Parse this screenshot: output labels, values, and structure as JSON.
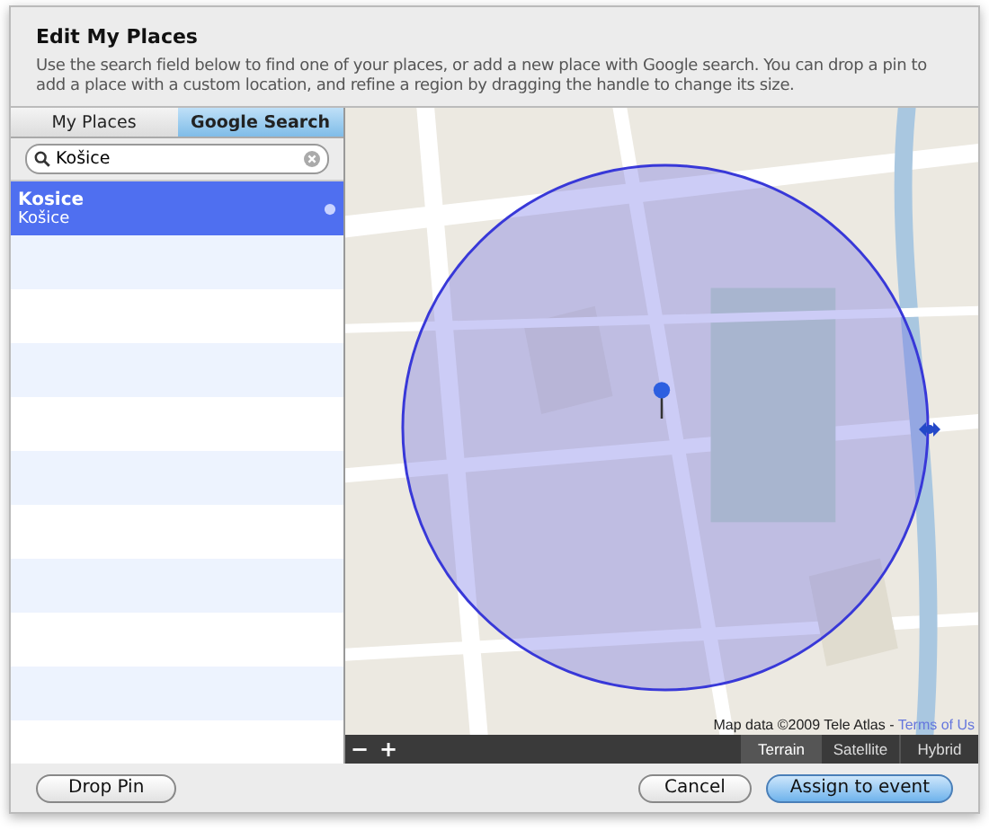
{
  "dialog": {
    "title": "Edit My Places",
    "description": "Use the search field below to find one of your places, or add a new place with Google search. You can drop a pin to add a place with a custom location, and refine a region by dragging the handle to change its size."
  },
  "tabs": [
    {
      "label": "My Places",
      "selected": false
    },
    {
      "label": "Google Search",
      "selected": true
    }
  ],
  "search": {
    "value": "Košice"
  },
  "results": [
    {
      "title": "Kosice",
      "subtitle": "Košice",
      "selected": true
    }
  ],
  "map": {
    "kind": "picture",
    "attribution": "Map data ©2009 Tele Atlas - ",
    "terms_link": "Terms of Us",
    "zoom_out": "−",
    "zoom_in": "+",
    "map_types": [
      {
        "label": "Terrain",
        "selected": true
      },
      {
        "label": "Satellite",
        "selected": false
      },
      {
        "label": "Hybrid",
        "selected": false
      }
    ]
  },
  "buttons": {
    "left": "Drop Pin",
    "cancel": "Cancel",
    "confirm": "Assign to event"
  }
}
